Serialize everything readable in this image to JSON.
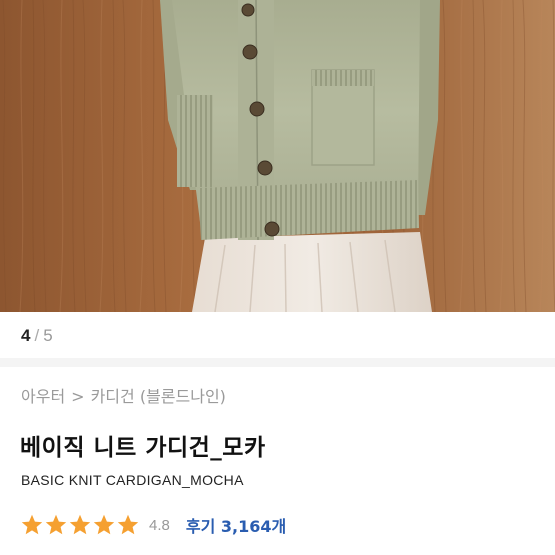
{
  "product_image": {
    "alt": "sage green knit cardigan over white skirt"
  },
  "gallery": {
    "current": "4",
    "separator": "/",
    "total": "5"
  },
  "breadcrumb": {
    "category": "아우터",
    "arrow": ">",
    "subcategory": "카디건 (블론드나인)"
  },
  "product": {
    "name_ko": "베이직 니트 가디건_모카",
    "name_en": "BASIC KNIT CARDIGAN_MOCHA"
  },
  "rating": {
    "stars": 5,
    "score": "4.8",
    "reviews_label": "후기 3,164개"
  },
  "colors": {
    "star": "#f5a031",
    "link": "#2a5db0",
    "cardigan": "#b9bea2",
    "wall": "#9c6438"
  }
}
